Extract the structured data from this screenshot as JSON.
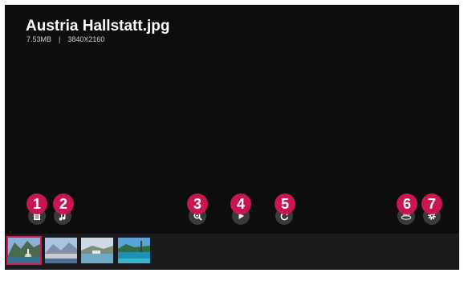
{
  "file": {
    "name": "Austria Hallstatt.jpg",
    "size": "7.53MB",
    "separator": "|",
    "resolution": "3840X2160"
  },
  "callouts": [
    "1",
    "2",
    "3",
    "4",
    "5",
    "6",
    "7"
  ],
  "controls": {
    "list_icon": "list-icon",
    "music_icon": "music-note-icon",
    "zoom_icon": "zoom-in-icon",
    "play_icon": "play-icon",
    "rotate_icon": "rotate-icon",
    "view360_icon": "360-view-icon",
    "view360_label": "360",
    "settings_icon": "gear-icon"
  },
  "thumbnails": [
    {
      "name": "hallstatt-thumbnail",
      "selected": true
    },
    {
      "name": "mountain-city-thumbnail",
      "selected": false
    },
    {
      "name": "bay-thumbnail",
      "selected": false
    },
    {
      "name": "tropical-beach-thumbnail",
      "selected": false
    }
  ],
  "colors": {
    "background": "#0d0d0f",
    "callout": "#c8174e",
    "selection": "#d31a55",
    "button": "#3a3a3d"
  }
}
